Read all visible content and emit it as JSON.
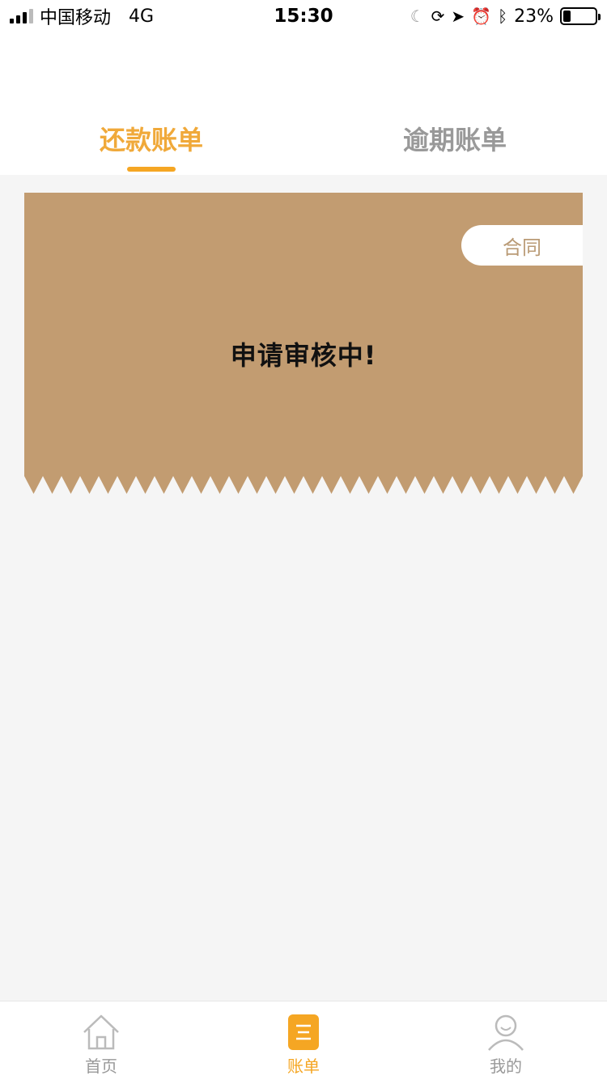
{
  "status_bar": {
    "carrier": "中国移动",
    "network": "4G",
    "time": "15:30",
    "battery": "23%",
    "battery_level": 0.23,
    "icons": [
      "moon-icon",
      "orientation-lock-icon",
      "location-icon",
      "alarm-icon",
      "bluetooth-icon"
    ]
  },
  "tabs": [
    {
      "label": "还款账单",
      "active": true
    },
    {
      "label": "逾期账单",
      "active": false
    }
  ],
  "bill_card": {
    "contract_label": "合同",
    "status_text": "申请审核中!",
    "color": "#c29c71"
  },
  "bottom_nav": [
    {
      "label": "首页",
      "icon": "home-icon",
      "active": false
    },
    {
      "label": "账单",
      "icon": "bill-icon",
      "active": true
    },
    {
      "label": "我的",
      "icon": "profile-icon",
      "active": false
    }
  ],
  "colors": {
    "accent": "#f5a623",
    "inactive": "#999999",
    "card": "#c29c71"
  }
}
